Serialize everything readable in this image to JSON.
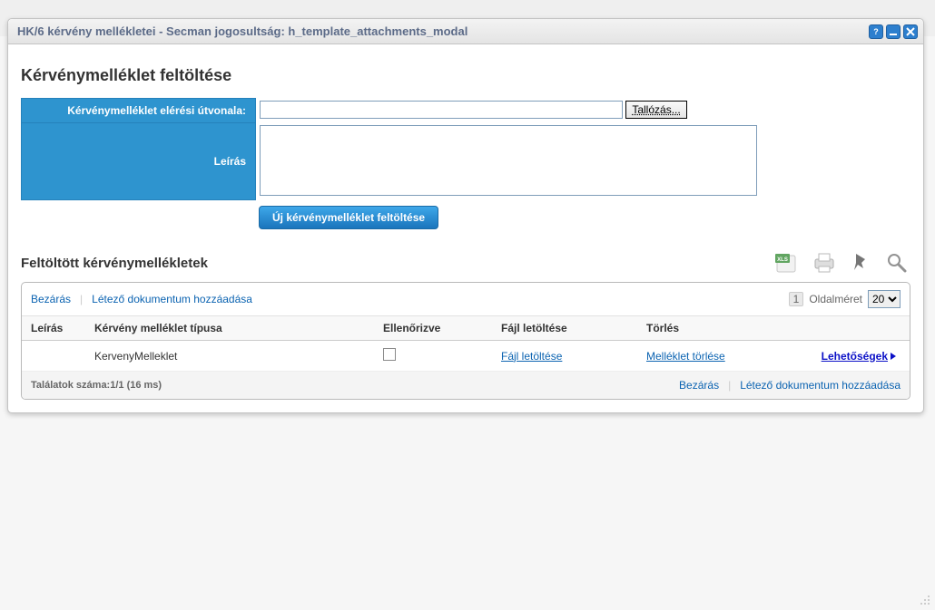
{
  "window": {
    "title": "HK/6 kérvény mellékletei - Secman jogosultság: h_template_attachments_modal"
  },
  "upload": {
    "heading": "Kérvénymelléklet feltöltése",
    "path_label": "Kérvénymelléklet elérési útvonala:",
    "path_value": "",
    "browse_label": "Tallózás...",
    "desc_label": "Leírás",
    "submit_label": "Új kérvénymelléklet feltöltése"
  },
  "list": {
    "heading": "Feltöltött kérvénymellékletek",
    "close_label": "Bezárás",
    "add_existing_label": "Létező dokumentum hozzáadása",
    "page": "1",
    "pagesize_label": "Oldalméret",
    "pagesize_value": "20",
    "columns": {
      "desc": "Leírás",
      "type": "Kérvény melléklet típusa",
      "checked": "Ellenőrizve",
      "download": "Fájl letöltése",
      "delete": "Törlés"
    },
    "rows": [
      {
        "desc": "",
        "type": "KervenyMelleklet",
        "checked": false,
        "download": "Fájl letöltése",
        "delete": "Melléklet törlése",
        "options": "Lehetőségek"
      }
    ],
    "results_text": "Találatok száma:1/1 (16 ms)"
  }
}
